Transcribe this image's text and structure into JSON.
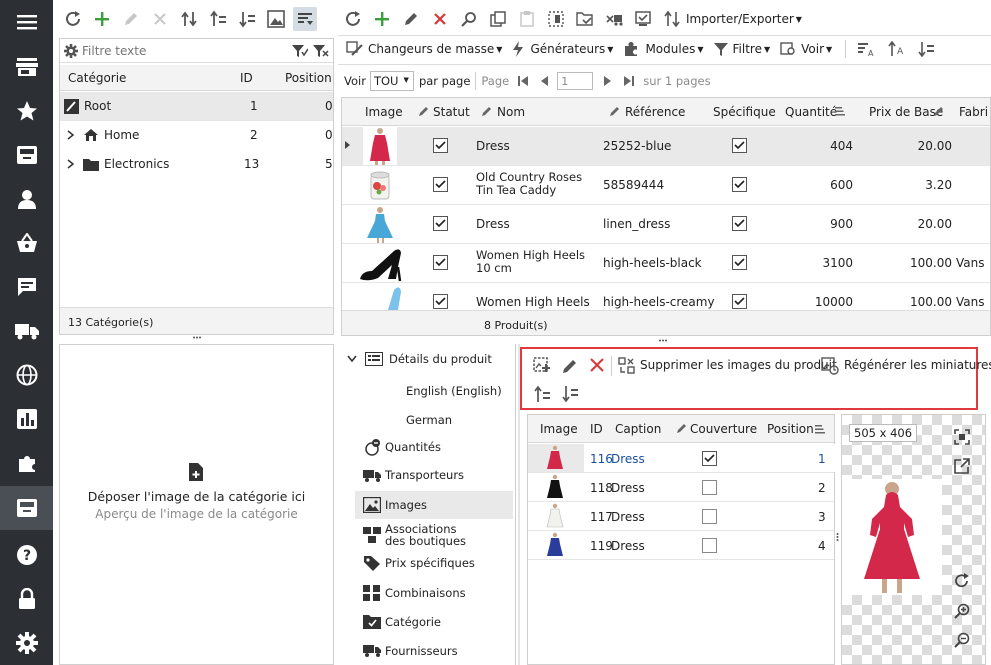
{
  "left_toolbar": {
    "icons": [
      "refresh-icon",
      "add-icon",
      "edit-icon",
      "delete-icon",
      "move-icon",
      "move-up-icon",
      "move-down-icon",
      "image-icon",
      "filter-icon"
    ]
  },
  "category_filter": {
    "placeholder": "Filtre texte"
  },
  "category_grid": {
    "columns": [
      "Catégorie",
      "ID",
      "Position"
    ],
    "rows": [
      {
        "name": "Root",
        "id": "1",
        "position": "0"
      },
      {
        "name": "Home",
        "id": "2",
        "position": "0"
      },
      {
        "name": "Electronics",
        "id": "13",
        "position": "5"
      }
    ],
    "footer": "13 Catégorie(s)"
  },
  "category_image": {
    "drop_text": "Déposer l'image de la catégorie ici",
    "preview_text": "Aperçu de l'image de la catégorie"
  },
  "main_toolbar": {
    "import_export": "Importer/Exporter"
  },
  "secondary_toolbar": {
    "mass_changers": "Changeurs de masse",
    "generators": "Générateurs",
    "modules": "Modules",
    "filter": "Filtre",
    "view": "Voir"
  },
  "pager": {
    "show_label": "Voir",
    "show_value": "TOU",
    "per_page": "par page",
    "page_label": "Page",
    "page_value": "1",
    "of_pages": "sur 1 pages"
  },
  "product_grid": {
    "columns": [
      "Image",
      "Statut",
      "Nom",
      "Référence",
      "Spécifique",
      "Quantité",
      "Prix de Base",
      "Fabri"
    ],
    "rows": [
      {
        "name": "Dress",
        "reference": "25252-blue",
        "quantity": "404",
        "price": "20.00",
        "maker": ""
      },
      {
        "name": "Old Country Roses Tin Tea Caddy",
        "reference": "58589444",
        "quantity": "600",
        "price": "3.20",
        "maker": ""
      },
      {
        "name": "Dress",
        "reference": "linen_dress",
        "quantity": "900",
        "price": "20.00",
        "maker": ""
      },
      {
        "name": "Women High Heels 10 cm",
        "reference": "high-heels-black",
        "quantity": "3100",
        "price": "100.00",
        "maker": "Vans"
      },
      {
        "name": "Women High Heels",
        "reference": "high-heels-creamy",
        "quantity": "10000",
        "price": "100.00",
        "maker": "Vans"
      }
    ],
    "footer": "8 Produit(s)"
  },
  "details_nav": {
    "header": "Détails du produit",
    "languages": [
      "English (English)",
      "German"
    ],
    "items": [
      "Quantités",
      "Transporteurs",
      "Images",
      "Associations des boutiques",
      "Prix spécifiques",
      "Combinaisons",
      "Catégorie",
      "Fournisseurs"
    ]
  },
  "images_toolbar": {
    "delete_images": "Supprimer les images du produit",
    "regenerate": "Régénérer les miniatures"
  },
  "images_grid": {
    "columns": [
      "Image",
      "ID",
      "Caption",
      "Couverture",
      "Position"
    ],
    "rows": [
      {
        "id": "116",
        "caption": "Dress",
        "position": "1",
        "cover": true
      },
      {
        "id": "118",
        "caption": "Dress",
        "position": "2",
        "cover": false
      },
      {
        "id": "117",
        "caption": "Dress",
        "position": "3",
        "cover": false
      },
      {
        "id": "119",
        "caption": "Dress",
        "position": "4",
        "cover": false
      }
    ]
  },
  "preview": {
    "size": "505 x 406"
  },
  "colors": {
    "sidebar": "#2c2f33",
    "highlight_box": "#e0393e",
    "link": "#1a4fa0",
    "green": "#3aa13a",
    "red": "#d93636"
  }
}
